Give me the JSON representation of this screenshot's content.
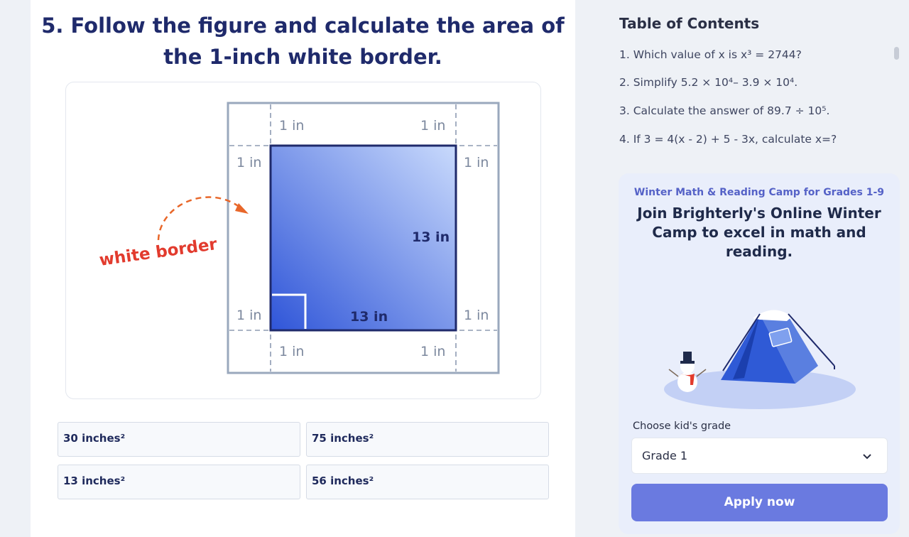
{
  "question": {
    "title_line1": "5. Follow the figure and calculate the area of",
    "title_line2": "the 1-inch white border."
  },
  "figure": {
    "border_labels": {
      "top_left": "1 in",
      "top_right": "1 in",
      "upper_left": "1 in",
      "upper_right": "1 in",
      "lower_left": "1 in",
      "lower_right": "1 in",
      "bottom_left": "1 in",
      "bottom_right": "1 in"
    },
    "side_label": "13 in",
    "bottom_label": "13 in",
    "callout": "white border"
  },
  "options": [
    {
      "label": "30 inches²"
    },
    {
      "label": "75 inches²"
    },
    {
      "label": "13 inches²"
    },
    {
      "label": "56 inches²"
    }
  ],
  "toc": {
    "title": "Table of Contents",
    "items": [
      "1. Which value of x is x³ = 2744?",
      "2. Simplify 5.2 × 10⁴– 3.9 × 10⁴.",
      "3. Calculate the answer of 89.7 ÷ 10⁵.",
      "4. If 3 = 4(x - 2) + 5 - 3x, calculate x=?"
    ]
  },
  "promo": {
    "kicker": "Winter Math & Reading Camp for Grades 1-9",
    "headline": "Join Brighterly's Online Winter Camp to excel in math and reading.",
    "grade_label": "Choose kid's grade",
    "grade_value": "Grade 1",
    "apply_label": "Apply now"
  },
  "colors": {
    "accent": "#6a7ae0",
    "title_navy": "#1f2a6b",
    "callout_red": "#e23b2e",
    "arrow_orange": "#e8672a",
    "frame": "#9aa8bd"
  }
}
